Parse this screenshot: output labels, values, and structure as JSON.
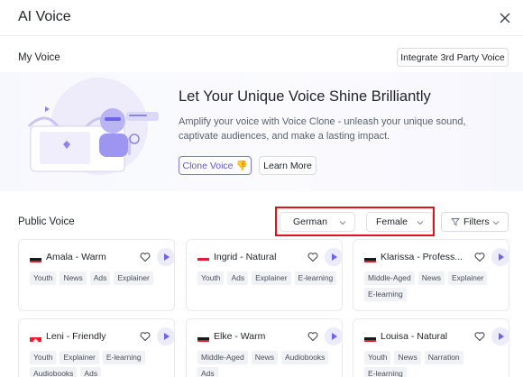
{
  "header": {
    "title": "AI Voice"
  },
  "my_voice": {
    "label": "My Voice",
    "integrate_label": "Integrate 3rd Party Voice"
  },
  "banner": {
    "title": "Let Your Unique Voice Shine Brilliantly",
    "description": "Amplify your voice with Voice Clone - unleash your unique sound, captivate audiences, and make a lasting impact.",
    "clone_label": "Clone Voice 👎",
    "learn_label": "Learn More"
  },
  "public_voice": {
    "label": "Public Voice",
    "language_value": "German",
    "gender_value": "Female",
    "filters_label": "Filters"
  },
  "colors": {
    "accent": "#6c63e8",
    "highlight": "#e0141e"
  },
  "cards": [
    {
      "name": "Amala - Warm",
      "flag": "germany",
      "tags": [
        "Youth",
        "News",
        "Ads",
        "Explainer"
      ]
    },
    {
      "name": "Ingrid - Natural",
      "flag": "austria",
      "tags": [
        "Youth",
        "Ads",
        "Explainer",
        "E-learning"
      ]
    },
    {
      "name": "Klarissa - Profess...",
      "flag": "germany",
      "tags": [
        "Middle-Aged",
        "News",
        "Explainer",
        "E-learning"
      ]
    },
    {
      "name": "Leni - Friendly",
      "flag": "switzerland",
      "tags": [
        "Youth",
        "Explainer",
        "E-learning",
        "Audiobooks",
        "Ads"
      ]
    },
    {
      "name": "Elke - Warm",
      "flag": "germany",
      "tags": [
        "Middle-Aged",
        "News",
        "Audiobooks",
        "Ads"
      ]
    },
    {
      "name": "Louisa - Natural",
      "flag": "germany",
      "tags": [
        "Youth",
        "News",
        "Narration",
        "E-learning"
      ]
    }
  ]
}
